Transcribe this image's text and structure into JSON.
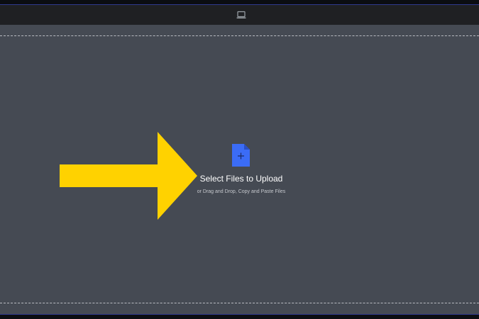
{
  "toolbar": {
    "device_icon": "laptop-icon"
  },
  "annotation": {
    "arrow_color": "#ffd200",
    "arrow_icon": "right-arrow"
  },
  "upload": {
    "title": "Select Files to Upload",
    "subtitle": "or Drag and Drop, Copy and Paste Files",
    "icon": "file-add-icon",
    "icon_color": "#3b6cf6"
  },
  "colors": {
    "canvas": "#454a53",
    "topbar": "#1f2023",
    "accent_line": "#2f3a8f"
  }
}
